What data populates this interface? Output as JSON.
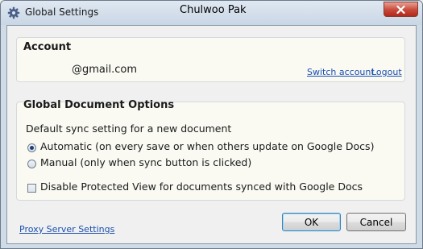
{
  "window": {
    "title": "Global Settings",
    "user": "Chulwoo Pak",
    "icon": "gear-icon",
    "close_icon": "close-icon"
  },
  "account": {
    "heading": "Account",
    "email": "@gmail.com",
    "switch_link": "Switch account",
    "logout_link": "Logout"
  },
  "doc_options": {
    "heading": "Global Document Options",
    "sync_label": "Default sync setting for a new document",
    "radio_automatic": "Automatic (on every save or when others update on Google Docs)",
    "radio_manual": "Manual (only when sync button is clicked)",
    "selected": "automatic",
    "checkbox_label": "Disable Protected View for documents synced with Google Docs",
    "checkbox_checked": false
  },
  "footer": {
    "proxy_link": "Proxy Server Settings",
    "ok_label": "OK",
    "cancel_label": "Cancel"
  },
  "colors": {
    "link": "#1a4fb0",
    "close_button": "#c8493a",
    "panel_background": "#fafaf3"
  }
}
